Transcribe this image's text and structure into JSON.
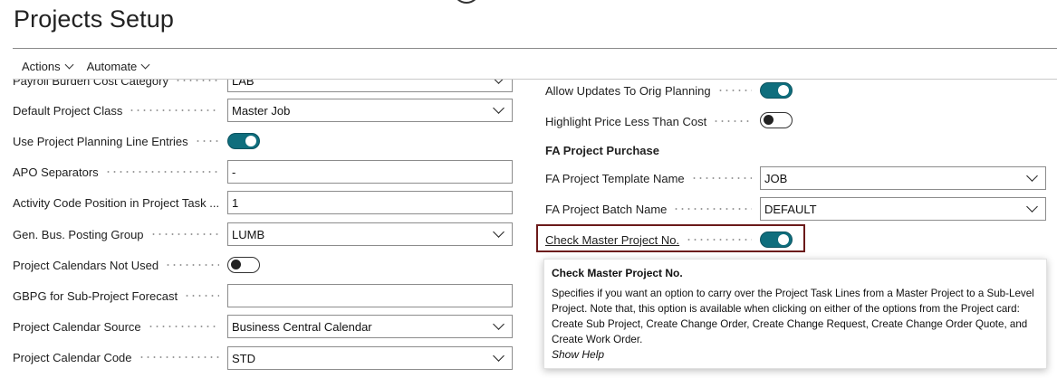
{
  "page": {
    "title": "Projects Setup"
  },
  "actionbar": {
    "items": [
      {
        "label": "Actions"
      },
      {
        "label": "Automate"
      }
    ]
  },
  "left_fields": [
    {
      "label": "Payroll Burden Cost Category",
      "type": "select",
      "value": "LAB"
    },
    {
      "label": "Default Project Class",
      "type": "select",
      "value": "Master Job"
    },
    {
      "label": "Use Project Planning Line Entries",
      "type": "toggle",
      "value": "on"
    },
    {
      "label": "APO Separators",
      "type": "text",
      "value": "-"
    },
    {
      "label": "Activity Code Position in Project Task ...",
      "type": "text",
      "value": "1"
    },
    {
      "label": "Gen. Bus. Posting Group",
      "type": "select",
      "value": "LUMB"
    },
    {
      "label": "Project Calendars Not Used",
      "type": "toggle",
      "value": "off"
    },
    {
      "label": "GBPG for Sub-Project Forecast",
      "type": "text",
      "value": ""
    },
    {
      "label": "Project Calendar Source",
      "type": "select",
      "value": "Business Central Calendar"
    },
    {
      "label": "Project Calendar Code",
      "type": "select",
      "value": "STD"
    }
  ],
  "right_fields": [
    {
      "label": "Allow Updates To Orig Planning",
      "type": "toggle",
      "value": "on"
    },
    {
      "label": "Highlight Price Less Than Cost",
      "type": "toggle",
      "value": "off"
    }
  ],
  "fa_section": {
    "title": "FA Project Purchase",
    "fields": [
      {
        "label": "FA Project Template Name",
        "type": "select",
        "value": "JOB"
      },
      {
        "label": "FA Project Batch Name",
        "type": "select",
        "value": "DEFAULT"
      },
      {
        "label": "Check Master Project No.",
        "type": "toggle",
        "value": "on"
      }
    ]
  },
  "tooltip": {
    "title": "Check Master Project No.",
    "body": "Specifies if you want an option to carry over the Project Task Lines from a Master Project to a Sub-Level Project. Note that, this option is available when clicking on either of the options from the Project card: Create Sub Project, Create Change Order, Create Change Request, Create Change Order Quote, and Create Work Order.",
    "help_link": "Show Help"
  },
  "colors": {
    "toggle_on": "#0f6e7d",
    "highlight_border": "#6b1a1a"
  },
  "icons": {
    "dropdown": "chevron-down-icon"
  }
}
